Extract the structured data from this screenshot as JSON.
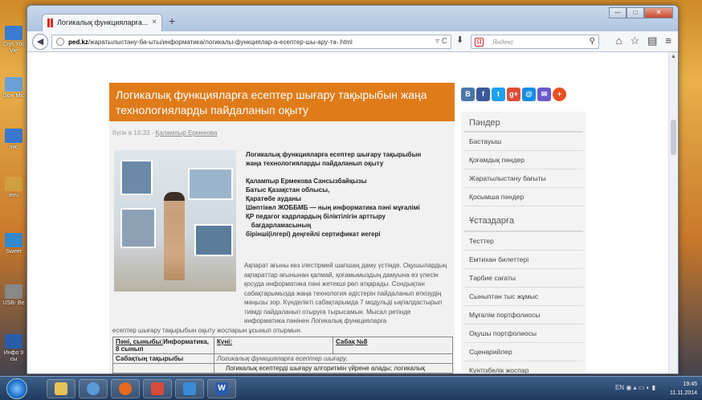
{
  "desktop": {
    "icons": [
      {
        "label": "Crys Yoc Vie",
        "color": "#3a7bd5"
      },
      {
        "label": "Dow Mic",
        "color": "#6aa0d8"
      },
      {
        "label": "mic",
        "color": "#3a78d0"
      },
      {
        "label": "Ieru",
        "color": "#d0a040"
      },
      {
        "label": "Sweet",
        "color": "#3388cc"
      },
      {
        "label": "USB- Be",
        "color": "#888888"
      },
      {
        "label": "Инфо 9 сы",
        "color": "#2a5ca8"
      }
    ]
  },
  "browser": {
    "tab_title": "Логикалық функцияларға...",
    "tab_close": "×",
    "new_tab": "+",
    "url_domain": "ped.kz",
    "url_path": "/жаратылыстану-ба-ыты/информатика/логикалы-функциялар-а-есептер-шы-ару-та-.html",
    "search_placeholder": "Яндекс",
    "window_buttons": {
      "min": "—",
      "max": "□",
      "close": "✕"
    }
  },
  "article": {
    "title": "Логикалық функцияларға есептер шығару тақырыбын жаңа технологияларды пайдаланып оқыту",
    "meta_time": "бүгін в 16:33 - ",
    "meta_author": "Қалампыр Ермекова",
    "bold_lines": [
      "Логикалық функцияларға есептер шығару тақырыбын",
      "жаңа технологияларды пайдаланып оқыту",
      "",
      "Қалампыр  Ермекова Сансызбайқызы",
      "Батыс Қазақстан облысы,",
      "Қаратөбе ауданы",
      "Шөптікөл ЖОББМБ — ның информатика пәні мұғалімі",
      "ҚР педагог кадрлардың біліктілігін арттыру",
      "   бағдарламасының",
      "бірінші(ілгері) деңгейлі сертификат иегері"
    ],
    "body_paragraph": "Ақпарат ағыны көз ілестірмей шапшаң  даму үстінде. Оқушылардың ақпараттар ағынынан қалмай, қоғамымыздың дамуына өз үлесін қосуда информатика пәні жетекші рөл атқарады. Сондықтан сабақтарымызда жаңа технология әдістерін пайдаланып өткізудің маңызы зор. Күнделікті сабақтарымда 7 модульді ықпалдастырып тиімді пайдаланып отыруға тырысамын. Мысал ретінде информатика пәнінен Логикалық функцияларға",
    "body_tail": "есептер шығару тақырыбын оқыту жоспарын ұсынып отырмын.",
    "table": {
      "r1c1": "Пәні, сыныбы:",
      "r1c1b": "Информатика, 8 сынып",
      "r1c2": "Күні:",
      "r1c3": "Сабақ №8",
      "r2c1": "Сабақтың тақырыбы",
      "r2c2": "Логикалық функцияларға есептер шығару.",
      "r3c2": "Логикалық есептерді шығару алгоритмін үйрене алады;  логикалық"
    }
  },
  "share": [
    {
      "label": "B",
      "color": "#4a76a8"
    },
    {
      "label": "f",
      "color": "#3b5998"
    },
    {
      "label": "t",
      "color": "#1da1f2"
    },
    {
      "label": "g+",
      "color": "#dd4b39"
    },
    {
      "label": "@",
      "color": "#168de2"
    },
    {
      "label": "✉",
      "color": "#6a5acd"
    },
    {
      "label": "+",
      "color": "#e8501f"
    }
  ],
  "sidebar": {
    "head1": "Пәндер",
    "items1": [
      "Бастауыш",
      "Қоғамдық пәндер",
      "Жаратылыстану бағыты",
      "Қосымша пәндер"
    ],
    "head2": "Ұстаздарға",
    "items2": [
      "Тесттер",
      "Емтихан билеттері",
      "Тәрбие сағаты",
      "Сыныптан тыс жұмыс",
      "Мұғалім портфолиосы",
      "Оқушы портфолиосы",
      "Сценарийлер",
      "Күнтізбелік жоспар"
    ]
  },
  "taskbar": {
    "time": "19:45",
    "date": "11.11.2014",
    "lang": "EN",
    "apps": [
      {
        "name": "explorer",
        "color": "#e8c25a"
      },
      {
        "name": "media",
        "color": "#5a9ad8"
      },
      {
        "name": "firefox",
        "color": "#e86a1a"
      },
      {
        "name": "paint",
        "color": "#d84a3a"
      },
      {
        "name": "store",
        "color": "#3a8ad8"
      },
      {
        "name": "word",
        "color": "#2a5cb0"
      }
    ]
  }
}
